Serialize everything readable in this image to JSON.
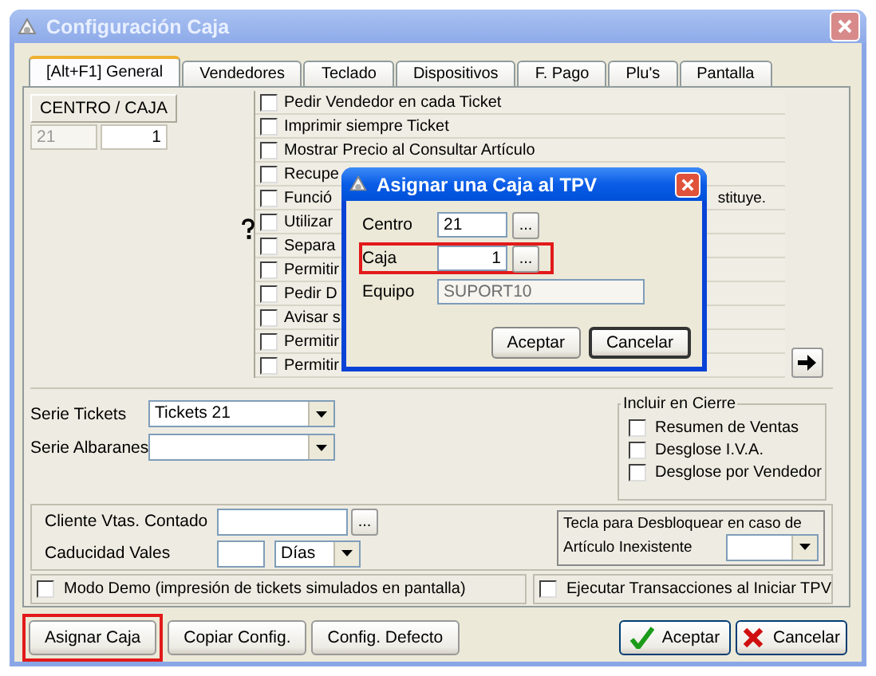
{
  "window": {
    "title": "Configuración Caja"
  },
  "tabs": [
    {
      "label": "[Alt+F1] General",
      "selected": true
    },
    {
      "label": "Vendedores",
      "selected": false
    },
    {
      "label": "Teclado",
      "selected": false
    },
    {
      "label": "Dispositivos",
      "selected": false
    },
    {
      "label": "F. Pago",
      "selected": false
    },
    {
      "label": "Plu's",
      "selected": false
    },
    {
      "label": "Pantalla",
      "selected": false
    }
  ],
  "centro_caja": {
    "heading": "CENTRO / CAJA",
    "centro": "21",
    "caja": "1"
  },
  "options": [
    {
      "label": "Pedir Vendedor en cada Ticket",
      "checked": false
    },
    {
      "label": "Imprimir siempre Ticket",
      "checked": false
    },
    {
      "label": "Mostrar Precio al Consultar Artículo",
      "checked": false
    },
    {
      "label": "Recupe",
      "checked": false
    },
    {
      "label": "Funció",
      "tail": "stituye.",
      "checked": false
    },
    {
      "label": "Utilizar",
      "checked": false
    },
    {
      "label": "Separa",
      "checked": false
    },
    {
      "label": "Permitir",
      "checked": false
    },
    {
      "label": "Pedir D",
      "checked": false
    },
    {
      "label": "Avisar s",
      "checked": false
    },
    {
      "label": "Permitir",
      "checked": false
    },
    {
      "label": "Permitir",
      "checked": false
    }
  ],
  "series": [
    {
      "label": "Serie Tickets",
      "value": "Tickets 21"
    },
    {
      "label": "Serie Albaranes"
    }
  ],
  "incluir_en_cierre": {
    "title": "Incluir en Cierre",
    "items": [
      {
        "label": "Resumen de Ventas",
        "checked": false
      },
      {
        "label": "Desglose I.V.A.",
        "checked": false
      },
      {
        "label": "Desglose por Vendedor",
        "checked": false
      }
    ]
  },
  "cliente_vtas_contado": {
    "label": "Cliente Vtas. Contado",
    "browse": "..."
  },
  "caducidad_vales": {
    "label": "Caducidad Vales",
    "unit": "Días"
  },
  "desbloquear": {
    "line_1": "Tecla para Desbloquear en caso de",
    "line_2": "Artículo Inexistente"
  },
  "modo_demo": {
    "label": "Modo Demo (impresión de tickets simulados en pantalla)",
    "checked": false
  },
  "ejecutar_transacciones": {
    "label": "Ejecutar Transacciones al Iniciar TPV",
    "checked": false
  },
  "buttons": [
    {
      "label": "Asignar Caja",
      "kind": "plain",
      "highlighted": true
    },
    {
      "label": "Copiar Config.",
      "kind": "plain",
      "highlighted": false
    },
    {
      "label": "Config. Defecto",
      "kind": "plain",
      "highlighted": false
    },
    {
      "label": "Aceptar",
      "kind": "ok",
      "highlighted": false
    },
    {
      "label": "Cancelar",
      "kind": "cancel",
      "highlighted": false
    }
  ],
  "dialog": {
    "title": "Asignar una Caja al TPV",
    "fields": [
      {
        "label": "Centro",
        "value": "21",
        "right_aligned": false,
        "disabled": false,
        "browse": "...",
        "highlighted": false
      },
      {
        "label": "Caja",
        "value": "1",
        "right_aligned": true,
        "disabled": false,
        "browse": "...",
        "highlighted": true
      },
      {
        "label": "Equipo",
        "value": "SUPORT10",
        "right_aligned": false,
        "disabled": true,
        "highlighted": false
      }
    ],
    "buttons": [
      {
        "label": "Aceptar",
        "focused": false
      },
      {
        "label": "Cancelar",
        "focused": true
      }
    ]
  }
}
